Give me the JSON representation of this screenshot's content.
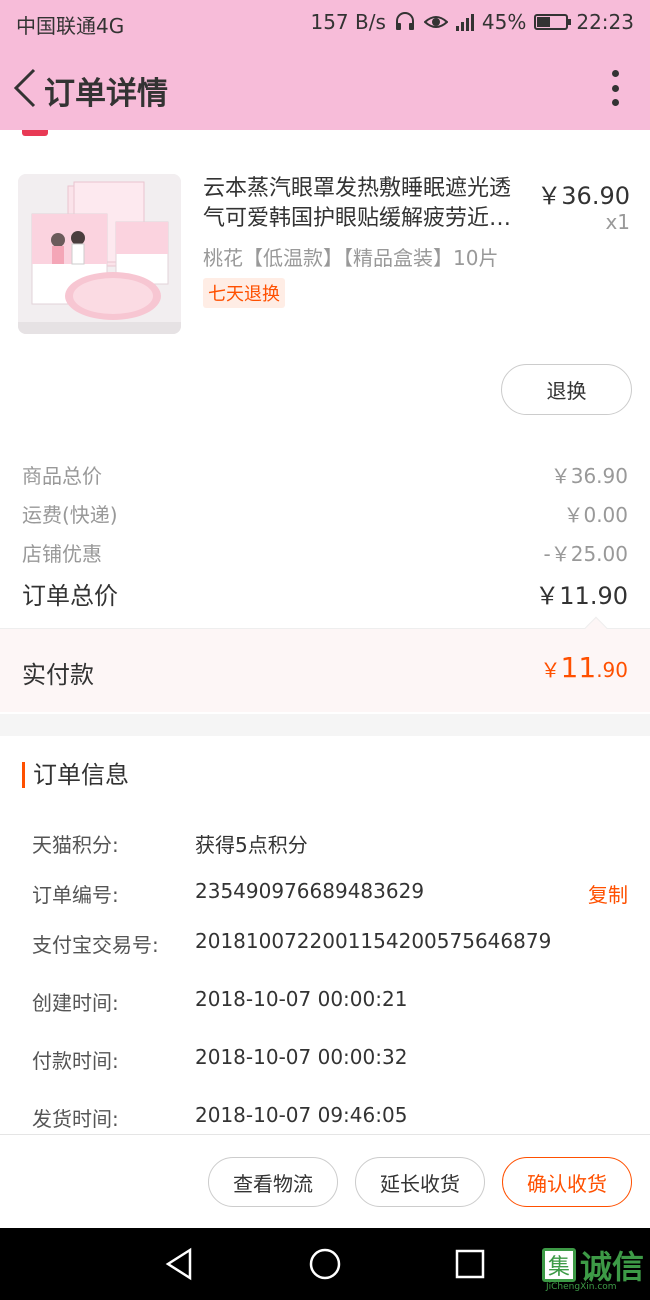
{
  "status_bar": {
    "carrier": "中国联通4G",
    "speed": "157 B/s",
    "battery_percent": "45%",
    "battery_level": 0.45,
    "time": "22:23"
  },
  "nav": {
    "title": "订单详情"
  },
  "product": {
    "name_line1": "云本蒸汽眼罩发热敷睡眠遮光透",
    "name_line2": "气可爱韩国护眼贴缓解疲劳近…",
    "price": "￥36.90",
    "quantity": "x1",
    "sku": "桃花【低温款】【精品盒装】10片",
    "tag": "七天退换",
    "refund_label": "退换"
  },
  "price_summary": {
    "rows": [
      {
        "label": "商品总价",
        "value": "￥36.90"
      },
      {
        "label": "运费(快递)",
        "value": "￥0.00"
      },
      {
        "label": "店铺优惠",
        "value": "-￥25.00"
      }
    ],
    "total_label": "订单总价",
    "total_value": "￥11.90"
  },
  "paid": {
    "label": "实付款",
    "symbol": "￥",
    "integer": "11",
    "decimal": ".90"
  },
  "order_info": {
    "title": "订单信息",
    "rows": [
      {
        "label": "天猫积分:",
        "value": "获得5点积分"
      },
      {
        "label": "订单编号:",
        "value": "235490976689483629"
      },
      {
        "label": "支付宝交易号:",
        "value": "2018100722001154200575646879"
      },
      {
        "label": "创建时间:",
        "value": "2018-10-07 00:00:21"
      },
      {
        "label": "付款时间:",
        "value": "2018-10-07 00:00:32"
      },
      {
        "label": "发货时间:",
        "value": "2018-10-07 09:46:05"
      }
    ],
    "copy_label": "复制"
  },
  "footer": {
    "logistics_label": "查看物流",
    "extend_label": "延长收货",
    "confirm_label": "确认收货"
  },
  "watermark": {
    "char": "集",
    "text": "诚信",
    "sub": "JiChengXin.com"
  },
  "colors": {
    "header_pink": "#f7bcd9",
    "accent_orange": "#ff5000"
  }
}
